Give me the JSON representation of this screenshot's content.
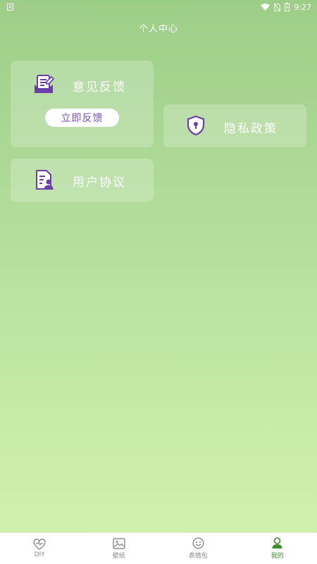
{
  "status_bar": {
    "left_badge": "A",
    "time": "9:27"
  },
  "header": {
    "title": "个人中心"
  },
  "cards": {
    "feedback": {
      "label": "意见反馈",
      "button_label": "立即反馈",
      "icon": "feedback-document-icon"
    },
    "privacy": {
      "label": "隐私政策",
      "icon": "shield-lock-icon"
    },
    "agreement": {
      "label": "用户协议",
      "icon": "user-document-icon"
    }
  },
  "tabs": [
    {
      "label": "DIY",
      "icon": "heart-diy-icon",
      "active": false
    },
    {
      "label": "壁纸",
      "icon": "image-icon",
      "active": false
    },
    {
      "label": "表情包",
      "icon": "smiley-icon",
      "active": false
    },
    {
      "label": "我的",
      "icon": "person-icon",
      "active": true
    }
  ],
  "colors": {
    "accent_purple": "#7a4fb8",
    "active_tab": "#3d8f2e",
    "background_top": "#9dce88",
    "background_bottom": "#d2f2b0"
  }
}
